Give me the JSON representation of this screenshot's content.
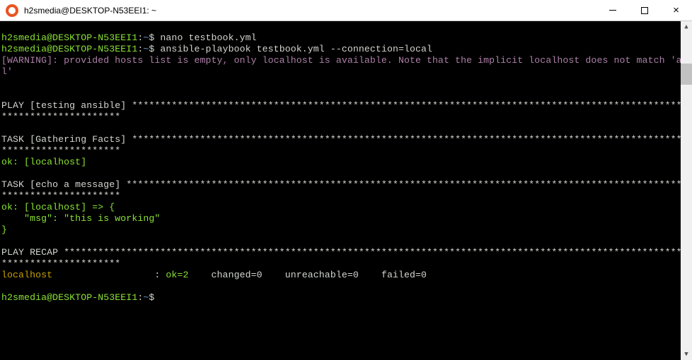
{
  "window": {
    "title": "h2smedia@DESKTOP-N53EEI1: ~"
  },
  "prompt": {
    "user_host": "h2smedia@DESKTOP-N53EEI1",
    "colon": ":",
    "path": "~",
    "dollar": "$"
  },
  "commands": {
    "c1": " nano testbook.yml",
    "c2": " ansible-playbook testbook.yml --connection=local"
  },
  "warning": "[WARNING]: provided hosts list is empty, only localhost is available. Note that the implicit localhost does not match 'all'",
  "blank": "",
  "play": {
    "label": "PLAY [testing ansible] ",
    "stars": "***********************************************************************************************************************"
  },
  "task_gather": {
    "label": "TASK [Gathering Facts] ",
    "stars": "***********************************************************************************************************************",
    "ok": "ok: [localhost]"
  },
  "task_echo": {
    "label": "TASK [echo a message] ",
    "stars": "************************************************************************************************************************",
    "ok_open": "ok: [localhost] => {",
    "msg": "    \"msg\": \"this is working\"",
    "close": "}"
  },
  "recap": {
    "label": "PLAY RECAP ",
    "stars": "***********************************************************************************************************************************",
    "host": "localhost",
    "host_pad": "                  ",
    "sep": ": ",
    "ok": "ok=2   ",
    "changed": " changed=0    unreachable=0    failed=0"
  }
}
